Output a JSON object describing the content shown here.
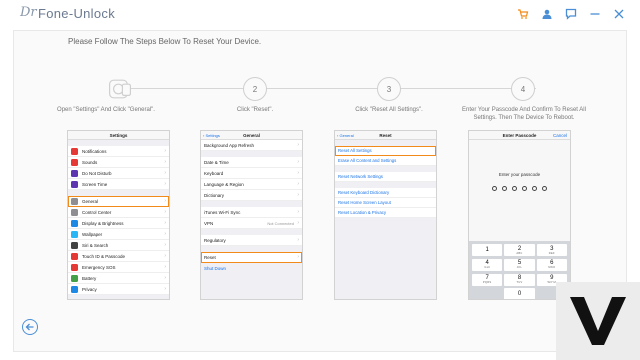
{
  "app": {
    "logo": "Dr",
    "title": "Fone-Unlock"
  },
  "toolbar": {
    "icons": [
      "cart-icon",
      "user-icon",
      "chat-icon",
      "minimize-icon",
      "close-icon"
    ]
  },
  "instruction": "Please Follow The Steps Below To Reset Your Device.",
  "steps": [
    {
      "number": "",
      "caption": "Open \"Settings\" And Click \"General\"."
    },
    {
      "number": "2",
      "caption": "Click \"Reset\"."
    },
    {
      "number": "3",
      "caption": "Click \"Reset All Settings\"."
    },
    {
      "number": "4",
      "caption": "Enter Your Passcode And Confirm To Reset All Settings. Then The Device To Reboot."
    }
  ],
  "phone1": {
    "title": "Settings",
    "group1": [
      {
        "label": "Notifications",
        "color": "#e53935"
      },
      {
        "label": "Sounds",
        "color": "#e53935"
      },
      {
        "label": "Do Not Disturb",
        "color": "#5e35b1"
      },
      {
        "label": "Screen Time",
        "color": "#5e35b1"
      }
    ],
    "group2": [
      {
        "label": "General",
        "color": "#8e8e93"
      },
      {
        "label": "Control Center",
        "color": "#8e8e93"
      },
      {
        "label": "Display & Brightness",
        "color": "#1e88e5"
      },
      {
        "label": "Wallpaper",
        "color": "#29b6f6"
      },
      {
        "label": "Siri & Search",
        "color": "#424242"
      },
      {
        "label": "Touch ID & Passcode",
        "color": "#e53935"
      },
      {
        "label": "Emergency SOS",
        "color": "#e53935"
      },
      {
        "label": "Battery",
        "color": "#43a047"
      },
      {
        "label": "Privacy",
        "color": "#1e88e5"
      }
    ]
  },
  "phone2": {
    "back": "Settings",
    "title": "General",
    "rows1": [
      "Background App Refresh"
    ],
    "rows2": [
      "Date & Time",
      "Keyboard",
      "Language & Region",
      "Dictionary"
    ],
    "rows3": [
      {
        "label": "iTunes Wi-Fi Sync",
        "value": ""
      },
      {
        "label": "VPN",
        "value": "Not Connected"
      }
    ],
    "rows4": [
      "Regulatory"
    ],
    "reset": "Reset",
    "shutdown": "Shut Down"
  },
  "phone3": {
    "back": "General",
    "title": "Reset",
    "group1": [
      "Reset All Settings",
      "Erase All Content and Settings"
    ],
    "group2": [
      "Reset Network Settings"
    ],
    "group3": [
      "Reset Keyboard Dictionary",
      "Reset Home Screen Layout",
      "Reset Location & Privacy"
    ]
  },
  "phone4": {
    "title": "Enter Passcode",
    "cancel": "Cancel",
    "prompt": "Enter your passcode",
    "keys": [
      {
        "num": "1",
        "letters": ""
      },
      {
        "num": "2",
        "letters": "ABC"
      },
      {
        "num": "3",
        "letters": "DEF"
      },
      {
        "num": "4",
        "letters": "GHI"
      },
      {
        "num": "5",
        "letters": "JKL"
      },
      {
        "num": "6",
        "letters": "MNO"
      },
      {
        "num": "7",
        "letters": "PQRS"
      },
      {
        "num": "8",
        "letters": "TUV"
      },
      {
        "num": "9",
        "letters": "WXYZ"
      },
      {
        "num": "",
        "letters": ""
      },
      {
        "num": "0",
        "letters": ""
      },
      {
        "num": "",
        "letters": ""
      }
    ]
  },
  "colors": {
    "accent": "#4a8fd6",
    "highlight": "#f28a1a"
  }
}
